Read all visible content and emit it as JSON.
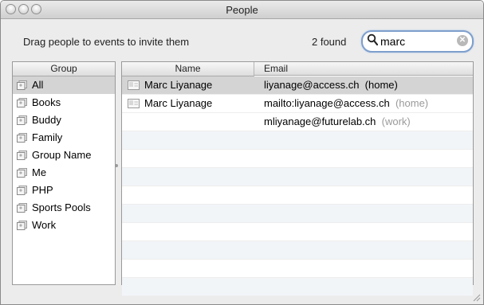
{
  "window": {
    "title": "People"
  },
  "toolbar": {
    "instruction": "Drag people to events to invite them",
    "found_count": "2 found",
    "search_value": "marc"
  },
  "groups": {
    "header": "Group",
    "items": [
      {
        "label": "All",
        "selected": true
      },
      {
        "label": "Books",
        "selected": false
      },
      {
        "label": "Buddy",
        "selected": false
      },
      {
        "label": "Family",
        "selected": false
      },
      {
        "label": "Group Name",
        "selected": false
      },
      {
        "label": "Me",
        "selected": false
      },
      {
        "label": "PHP",
        "selected": false
      },
      {
        "label": "Sports Pools",
        "selected": false
      },
      {
        "label": "Work",
        "selected": false
      }
    ]
  },
  "people": {
    "headers": {
      "name": "Name",
      "email": "Email"
    },
    "rows": [
      {
        "name": "Marc Liyanage",
        "email": "liyanage@access.ch",
        "tag": "(home)"
      },
      {
        "name": "Marc Liyanage",
        "email": "mailto:liyanage@access.ch",
        "tag": "(home)"
      },
      {
        "name": "",
        "email": "mliyanage@futurelab.ch",
        "tag": "(work)"
      }
    ]
  }
}
